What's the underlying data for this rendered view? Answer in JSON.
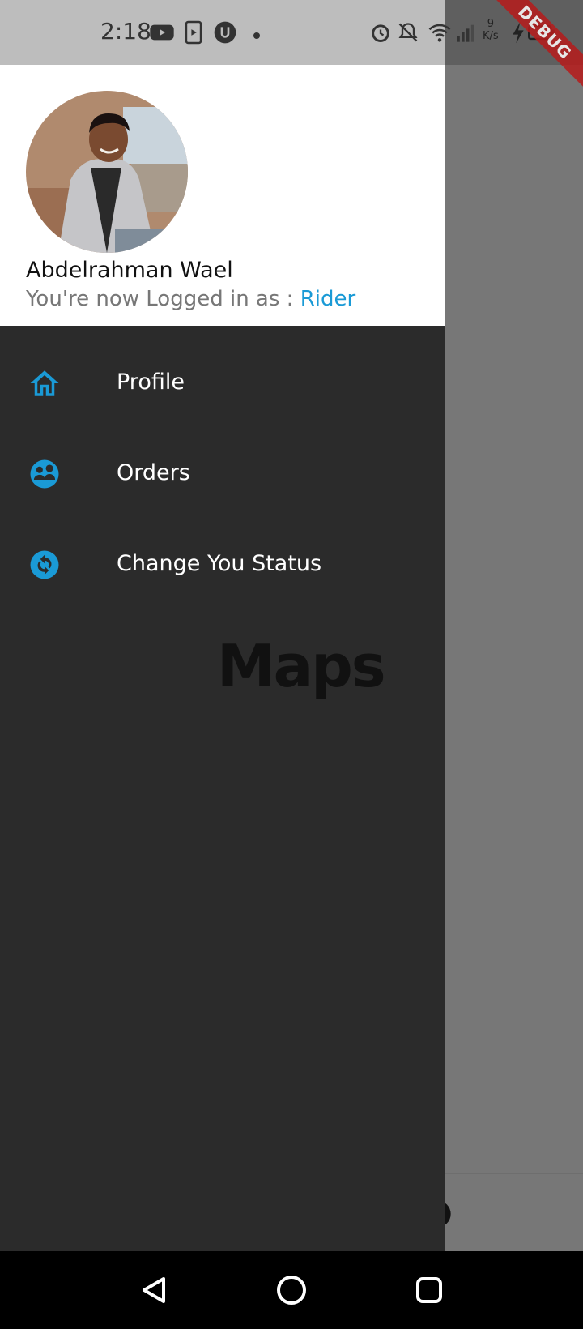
{
  "status_bar": {
    "time": "2:18",
    "net_speed_value": "9",
    "net_speed_unit": "K/s",
    "icons": [
      "youtube-icon",
      "media-icon",
      "vpn-icon",
      "dot-icon",
      "alarm-icon",
      "mute-icon",
      "wifi-icon",
      "signal-icon",
      "charging-icon",
      "battery-icon"
    ]
  },
  "debug_banner": "DEBUG",
  "drawer": {
    "user_name": "Abdelrahman Wael",
    "login_prefix": "You're now Logged in as : ",
    "role": "Rider",
    "menu": [
      {
        "label": "Profile",
        "icon": "home-outline-icon"
      },
      {
        "label": "Orders",
        "icon": "people-circle-icon"
      },
      {
        "label": "Change You Status",
        "icon": "sync-circle-icon"
      }
    ]
  },
  "page": {
    "title": "Maps"
  },
  "bottom_nav": {
    "items": [
      {
        "icon": "home-icon"
      },
      {
        "icon": "info-icon"
      }
    ]
  },
  "colors": {
    "accent": "#1a9ad6",
    "drawer_bg": "#2b2b2b",
    "scrim": "#777777"
  }
}
